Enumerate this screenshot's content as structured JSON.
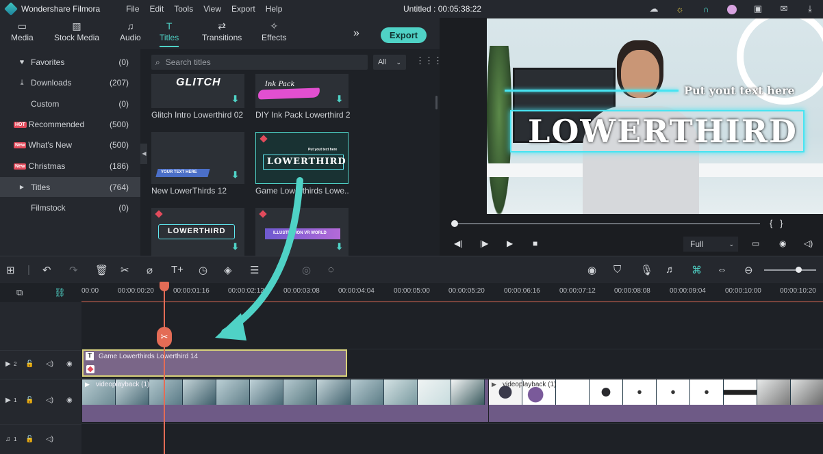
{
  "app": {
    "name": "Wondershare Filmora",
    "document": "Untitled : 00:05:38:22"
  },
  "menu": [
    "File",
    "Edit",
    "Tools",
    "View",
    "Export",
    "Help"
  ],
  "title_icons": [
    "cloud-icon",
    "bulb-icon",
    "headset-icon",
    "avatar-icon",
    "save-icon",
    "mail-icon",
    "download-icon"
  ],
  "tabs": [
    {
      "label": "Media",
      "icon": "folder-icon"
    },
    {
      "label": "Stock Media",
      "icon": "image-icon"
    },
    {
      "label": "Audio",
      "icon": "music-icon"
    },
    {
      "label": "Titles",
      "icon": "text-icon",
      "active": true
    },
    {
      "label": "Transitions",
      "icon": "transition-icon"
    },
    {
      "label": "Effects",
      "icon": "effects-icon"
    }
  ],
  "toolbar": {
    "more": "»",
    "export_label": "Export"
  },
  "sidebar": [
    {
      "label": "Favorites",
      "count": "(0)",
      "icon": "heart-icon"
    },
    {
      "label": "Downloads",
      "count": "(207)",
      "icon": "download-icon"
    },
    {
      "label": "Custom",
      "count": "(0)"
    },
    {
      "label": "Recommended",
      "count": "(500)",
      "badge": "HOT"
    },
    {
      "label": "What's New",
      "count": "(500)",
      "badge": "New"
    },
    {
      "label": "Christmas",
      "count": "(186)",
      "badge": "New"
    },
    {
      "label": "Titles",
      "count": "(764)",
      "selected": true,
      "icon": "triangle-right-icon"
    },
    {
      "label": "Filmstock",
      "count": "(0)"
    }
  ],
  "search": {
    "placeholder": "Search titles",
    "filter": "All"
  },
  "thumbs": [
    {
      "caption": "Glitch Intro Lowerthird 02",
      "art": "GLITCH"
    },
    {
      "caption": "DIY Ink Pack Lowerthird 2",
      "art": "Ink Pack"
    },
    {
      "caption": "New LowerThirds 12",
      "art": "YOUR TEXT HERE"
    },
    {
      "caption": "Game Lowerthirds Lowe...",
      "art": "LOWERTHIRD",
      "art_sub": "Put yout text here",
      "selected": true
    },
    {
      "caption": "",
      "art": "LOWERTHIRD"
    },
    {
      "caption": "",
      "art": "ILLUSTRATION VR WORLD"
    }
  ],
  "preview": {
    "overlay_sub": "Put yout text here",
    "overlay_main": "LOWERTHIRD",
    "quality": "Full",
    "brackets": "{   }"
  },
  "timeline": {
    "ticks": [
      "00:00",
      "00:00:00:20",
      "00:00:01:16",
      "00:00:02:12",
      "00:00:03:08",
      "00:00:04:04",
      "00:00:05:00",
      "00:00:05:20",
      "00:00:06:16",
      "00:00:07:12",
      "00:00:08:08",
      "00:00:09:04",
      "00:00:10:00",
      "00:00:10:20"
    ],
    "title_clip": "Game Lowerthirds Lowerthird 14",
    "video_clip1": "videoplayback (1)",
    "video_clip2": "videoplayback (1)",
    "tracks": [
      {
        "num": "2"
      },
      {
        "num": "1"
      },
      {
        "num": "1"
      }
    ]
  },
  "colors": {
    "accent": "#4fd2c6",
    "playhead": "#e46c56",
    "clip": "#6e5a86",
    "hot_badge": "#e24b5c"
  }
}
